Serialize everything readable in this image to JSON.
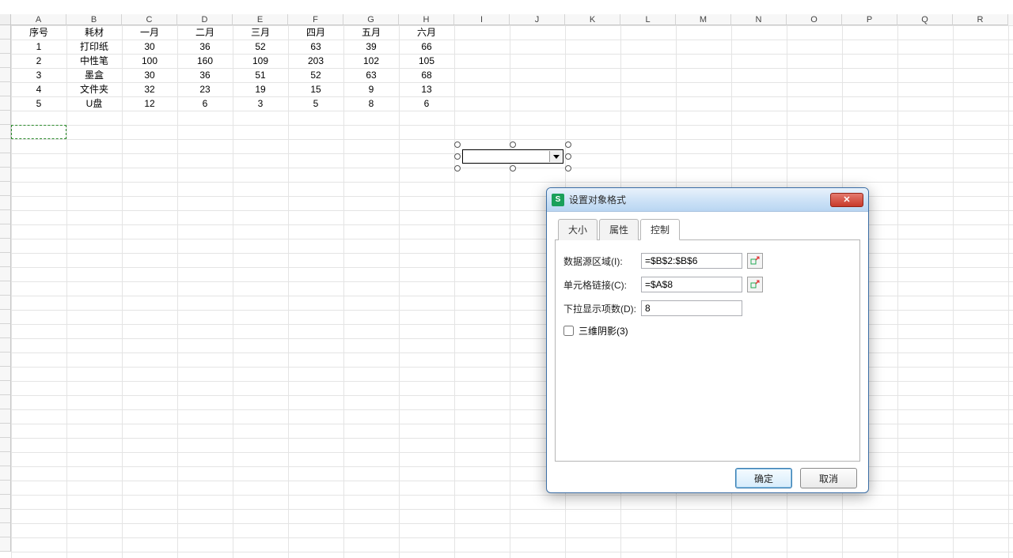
{
  "columns": [
    "A",
    "B",
    "C",
    "D",
    "E",
    "F",
    "G",
    "H",
    "I",
    "J",
    "K",
    "L",
    "M",
    "N",
    "O",
    "P",
    "Q",
    "R"
  ],
  "table": {
    "headers": [
      "序号",
      "耗材",
      "一月",
      "二月",
      "三月",
      "四月",
      "五月",
      "六月"
    ],
    "rows": [
      [
        "1",
        "打印纸",
        "30",
        "36",
        "52",
        "63",
        "39",
        "66"
      ],
      [
        "2",
        "中性笔",
        "100",
        "160",
        "109",
        "203",
        "102",
        "105"
      ],
      [
        "3",
        "墨盒",
        "30",
        "36",
        "51",
        "52",
        "63",
        "68"
      ],
      [
        "4",
        "文件夹",
        "32",
        "23",
        "19",
        "15",
        "9",
        "13"
      ],
      [
        "5",
        "U盘",
        "12",
        "6",
        "3",
        "5",
        "8",
        "6"
      ]
    ]
  },
  "dialog": {
    "icon_letter": "S",
    "title": "设置对象格式",
    "close_glyph": "✕",
    "tabs": {
      "size": "大小",
      "attr": "属性",
      "control": "控制"
    },
    "fields": {
      "input_range_label": "数据源区域(I):",
      "input_range_value": "=$B$2:$B$6",
      "cell_link_label": "单元格链接(C):",
      "cell_link_value": "=$A$8",
      "dropdown_lines_label": "下拉显示项数(D):",
      "dropdown_lines_value": "8",
      "shadow_label": "三维阴影(3)"
    },
    "buttons": {
      "ok": "确定",
      "cancel": "取消"
    }
  }
}
